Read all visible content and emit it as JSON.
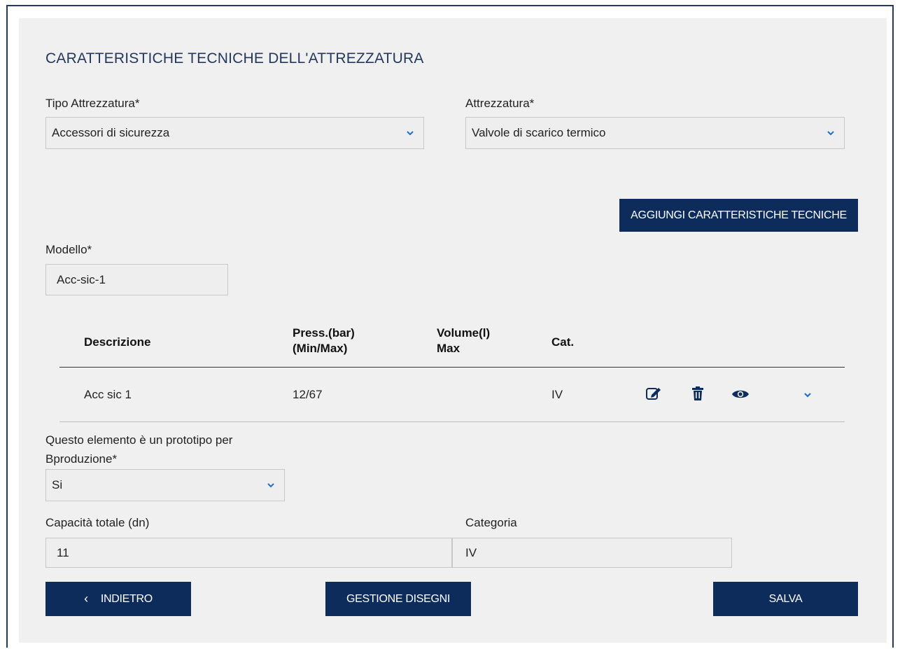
{
  "section_title": "CARATTERISTICHE TECNICHE DELL'ATTREZZATURA",
  "tipo_attrezzatura": {
    "label": "Tipo Attrezzatura*",
    "value": "Accessori di sicurezza"
  },
  "attrezzatura": {
    "label": "Attrezzatura*",
    "value": "Valvole di scarico termico"
  },
  "add_button": "AGGIUNGI CARATTERISTICHE TECNICHE",
  "modello": {
    "label": "Modello*",
    "value": "Acc-sic-1"
  },
  "table": {
    "headers": {
      "descrizione": "Descrizione",
      "press_1": "Press.(bar)",
      "press_2": "(Min/Max)",
      "volume_1": "Volume(l)",
      "volume_2": "Max",
      "cat": "Cat."
    },
    "rows": [
      {
        "descrizione": "Acc sic 1",
        "press": "12/67",
        "volume": "",
        "cat": "IV"
      }
    ]
  },
  "prototipo": {
    "label_1": "Questo elemento è un prototipo per",
    "label_2": "Bproduzione*",
    "value": "Si"
  },
  "capacita": {
    "label": "Capacità totale (dn)",
    "value": "11"
  },
  "categoria": {
    "label": "Categoria",
    "value": "IV"
  },
  "buttons": {
    "back_icon": "‹",
    "back": "INDIETRO",
    "drawings": "GESTIONE DISEGNI",
    "save": "SALVA"
  },
  "colors": {
    "primary": "#0d2c5c",
    "accent": "#1f6fc9",
    "panel": "#f0f0f0"
  }
}
